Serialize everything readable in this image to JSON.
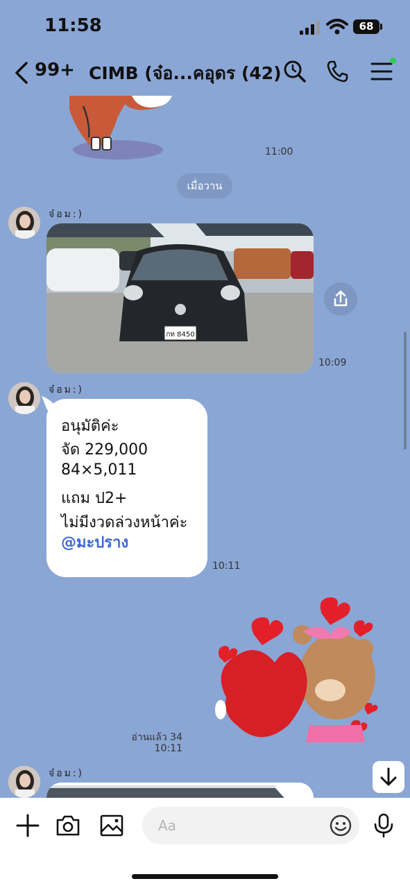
{
  "status_bar": {
    "time": "11:58",
    "battery": "68"
  },
  "header": {
    "unread": "99+",
    "title": "CIMB (จ๋อ...คอุดร (42)"
  },
  "messages": {
    "sticker_time": "11:00",
    "date_divider": "เมื่อวาน",
    "photo_msg": {
      "sender": "จ๋อม:)",
      "time": "10:09",
      "plate": "กท 8450"
    },
    "text_msg": {
      "sender": "จ๋อม:)",
      "lines": [
        "อนุมัติค่ะ",
        "จัด 229,000",
        "84×5,011",
        "แถม ป2+",
        "ไม่มีงวดล่วงหน้าค่ะ"
      ],
      "mention": "@มะปราง",
      "time": "10:11"
    },
    "sticker_msg": {
      "read": "อ่านแล้ว 34",
      "time": "10:11"
    },
    "last_msg": {
      "sender": "จ๋อม:)"
    }
  },
  "composer": {
    "placeholder": "Aa"
  },
  "colors": {
    "background": "#8aa6d4",
    "mention": "#3d68d8",
    "online": "#2ecc52"
  },
  "icons": [
    "back-chevron-icon",
    "search-icon",
    "phone-icon",
    "menu-icon",
    "share-icon",
    "arrow-down-icon",
    "plus-icon",
    "camera-icon",
    "image-icon",
    "emoji-icon",
    "microphone-icon"
  ]
}
